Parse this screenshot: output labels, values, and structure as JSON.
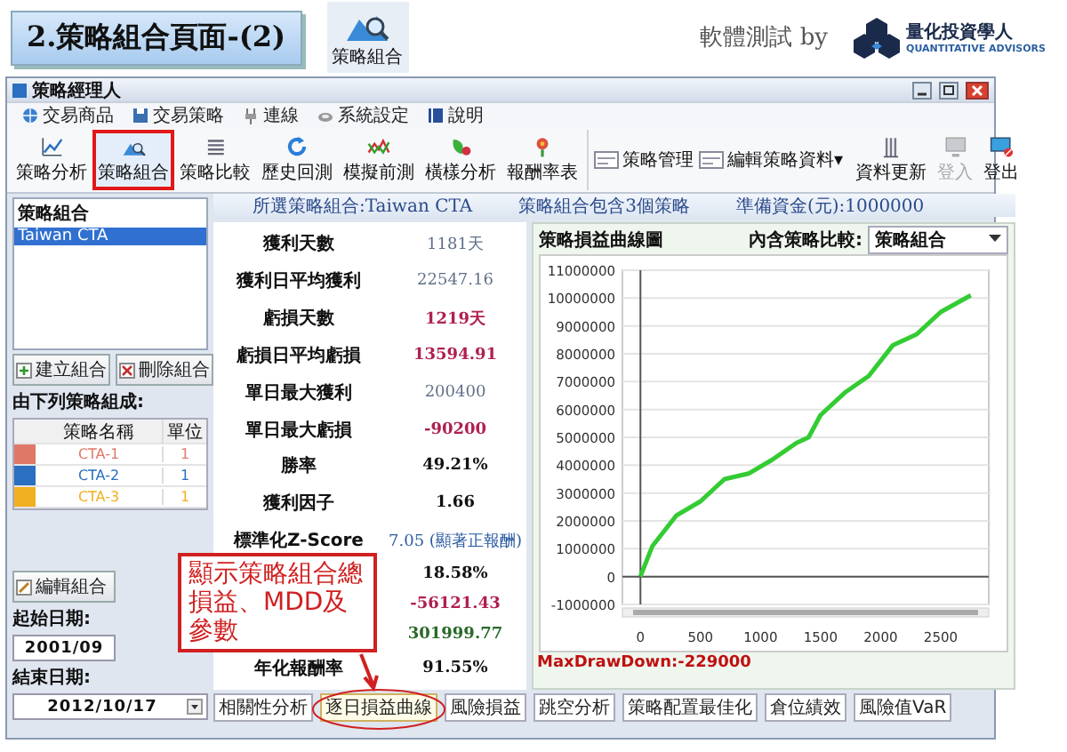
{
  "header": {
    "title": "2.策略組合頁面-(2)",
    "app_icon_label": "策略組合",
    "credit": "軟體測試 by",
    "logo_name": "量化投資學人",
    "logo_subtitle": "QUANTITATIVE ADVISORS"
  },
  "window": {
    "title": "策略經理人"
  },
  "menu": [
    "交易商品",
    "交易策略",
    "連線",
    "系統設定",
    "說明"
  ],
  "toolbar": {
    "tools": [
      {
        "label": "策略分析",
        "selected": false
      },
      {
        "label": "策略組合",
        "selected": true
      },
      {
        "label": "策略比較",
        "selected": false
      },
      {
        "label": "歷史回測",
        "selected": false
      },
      {
        "label": "模擬前測",
        "selected": false
      },
      {
        "label": "橫樣分析",
        "selected": false
      },
      {
        "label": "報酬率表",
        "selected": false
      }
    ],
    "manage": [
      "策略管理",
      "編輯策略資料▾"
    ],
    "right_tools": [
      {
        "label": "資料更新",
        "disabled": false
      },
      {
        "label": "登入",
        "disabled": true
      },
      {
        "label": "登出",
        "disabled": false
      }
    ]
  },
  "info_bar": {
    "portfolio": "所選策略組合:Taiwan CTA",
    "count": "策略組合包含3個策略",
    "capital": "準備資金(元):1000000"
  },
  "sidebar": {
    "heading": "策略組合",
    "portfolios": [
      {
        "name": "Taiwan CTA",
        "selected": true
      }
    ],
    "buttons": [
      "建立組合",
      "刪除組合"
    ],
    "components_label": "由下列策略組成:",
    "columns": [
      "策略名稱",
      "單位"
    ],
    "components": [
      {
        "name": "CTA-1",
        "units": "1",
        "color": "#e07868"
      },
      {
        "name": "CTA-2",
        "units": "1",
        "color": "#2a6fc0"
      },
      {
        "name": "CTA-3",
        "units": "1",
        "color": "#f0b020"
      }
    ],
    "edit_button": "編輯組合",
    "start_label": "起始日期:",
    "start_date": "2001/09",
    "end_label": "結束日期:",
    "end_date": "2012/10/17"
  },
  "stats": [
    {
      "label": "獲利天數",
      "value": "1181天",
      "kind": "neutral"
    },
    {
      "label": "獲利日平均獲利",
      "value": "22547.16",
      "kind": "neutral"
    },
    {
      "label": "虧損天數",
      "value": "1219天",
      "kind": "loss"
    },
    {
      "label": "虧損日平均虧損",
      "value": "13594.91",
      "kind": "loss"
    },
    {
      "label": "單日最大獲利",
      "value": "200400",
      "kind": "neutral"
    },
    {
      "label": "單日最大虧損",
      "value": "-90200",
      "kind": "loss"
    },
    {
      "label": "勝率",
      "value": "49.21%",
      "kind": "plain"
    },
    {
      "label": "獲利因子",
      "value": "1.66",
      "kind": "plain"
    },
    {
      "label": "標準化Z-Score",
      "value": "7.05 (顯著正報酬)",
      "kind": "link"
    },
    {
      "value": "18.58%",
      "kind": "plain"
    },
    {
      "value": "-56121.43",
      "kind": "loss"
    },
    {
      "value": "301999.77",
      "kind": "gain"
    },
    {
      "label": "年化報酬率",
      "value": "91.55%",
      "kind": "plain"
    }
  ],
  "chart_panel": {
    "title": "策略損益曲線圖",
    "compare_label": "內含策略比較:",
    "compare_value": "策略組合",
    "max_drawdown": "MaxDrawDown:-229000",
    "chart_data": {
      "type": "line",
      "x": [
        0,
        100,
        300,
        500,
        700,
        900,
        1100,
        1300,
        1400,
        1500,
        1700,
        1900,
        2100,
        2300,
        2500,
        2750
      ],
      "series": [
        {
          "color": "#33cc33",
          "values": [
            0,
            1100000,
            2200000,
            2700000,
            3500000,
            3700000,
            4200000,
            4800000,
            5000000,
            5800000,
            6600000,
            7200000,
            8300000,
            8700000,
            9500000,
            10100000
          ]
        }
      ],
      "xlim": [
        -150,
        2900
      ],
      "ylim": [
        -1000000,
        11000000
      ],
      "xticks": [
        0,
        500,
        1000,
        1500,
        2000,
        2500
      ],
      "yticks": [
        -1000000,
        0,
        1000000,
        2000000,
        3000000,
        4000000,
        5000000,
        6000000,
        7000000,
        8000000,
        9000000,
        10000000,
        11000000
      ],
      "grid": true
    }
  },
  "tabs": [
    {
      "label": "相關性分析",
      "selected": false
    },
    {
      "label": "逐日損益曲線",
      "selected": true
    },
    {
      "label": "風險損益",
      "selected": false
    },
    {
      "label": "跳空分析",
      "selected": false
    },
    {
      "label": "策略配置最佳化",
      "selected": false
    },
    {
      "label": "倉位績效",
      "selected": false
    },
    {
      "label": "風險值VaR",
      "selected": false
    }
  ],
  "callout": {
    "text": "顯示策略組合總損益、MDD及參數"
  }
}
